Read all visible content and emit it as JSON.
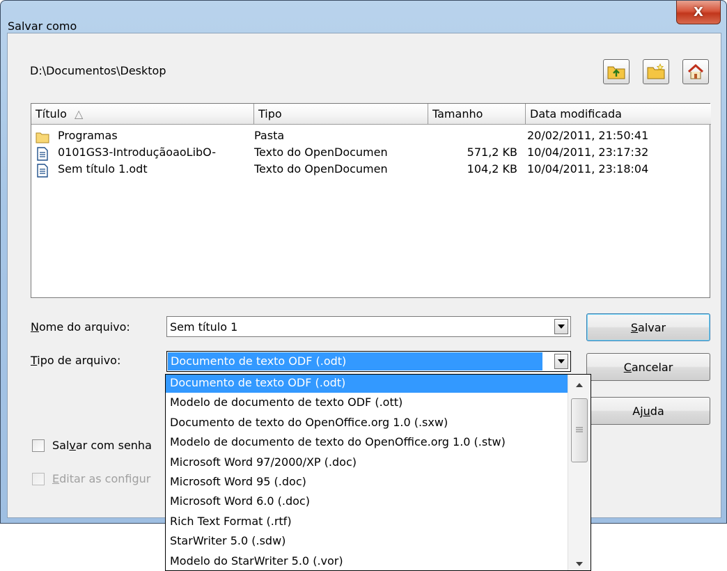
{
  "window": {
    "title": "Salvar como",
    "close_label": "X"
  },
  "path": "D:\\Documentos\\Desktop",
  "toolbar": {
    "icons": [
      "folder-up-icon",
      "new-folder-icon",
      "home-icon"
    ]
  },
  "columns": {
    "title": "Título",
    "sort_indicator": "△",
    "type": "Tipo",
    "size": "Tamanho",
    "modified": "Data modificada"
  },
  "files": [
    {
      "name": "Programas",
      "type": "Pasta",
      "size": "",
      "modified": "20/02/2011, 21:50:41",
      "icon": "folder-icon"
    },
    {
      "name": "0101GS3-IntroduçãoaoLibO-",
      "type": "Texto do OpenDocumen",
      "size": "571,2 KB",
      "modified": "10/04/2011, 23:17:32",
      "icon": "document-icon"
    },
    {
      "name": "Sem título 1.odt",
      "type": "Texto do OpenDocumen",
      "size": "104,2 KB",
      "modified": "10/04/2011, 23:18:04",
      "icon": "document-icon"
    }
  ],
  "filename": {
    "label_underlined": "N",
    "label_rest": "ome do arquivo:",
    "value": "Sem título 1"
  },
  "filetype": {
    "label_underlined": "T",
    "label_rest": "ipo de arquivo:",
    "value": "Documento de texto ODF (.odt)"
  },
  "buttons": {
    "save": {
      "u": "S",
      "rest": "alvar"
    },
    "cancel": {
      "u": "C",
      "rest": "ancelar"
    },
    "help": {
      "pre": "Aj",
      "u": "u",
      "rest": "da"
    }
  },
  "options": {
    "password": {
      "pre": "Sal",
      "u": "v",
      "rest": "ar com senha"
    },
    "edit_filter": {
      "u": "E",
      "rest": "ditar as configur"
    }
  },
  "filetype_options": [
    "Documento de texto ODF (.odt)",
    "Modelo de documento de texto ODF (.ott)",
    "Documento de texto do OpenOffice.org 1.0 (.sxw)",
    "Modelo de documento de texto do OpenOffice.org 1.0 (.stw)",
    "Microsoft Word 97/2000/XP (.doc)",
    "Microsoft Word 95 (.doc)",
    "Microsoft Word 6.0 (.doc)",
    "Rich Text Format (.rtf)",
    "StarWriter 5.0 (.sdw)",
    "Modelo do StarWriter 5.0 (.vor)"
  ],
  "filetype_selected_index": 0
}
